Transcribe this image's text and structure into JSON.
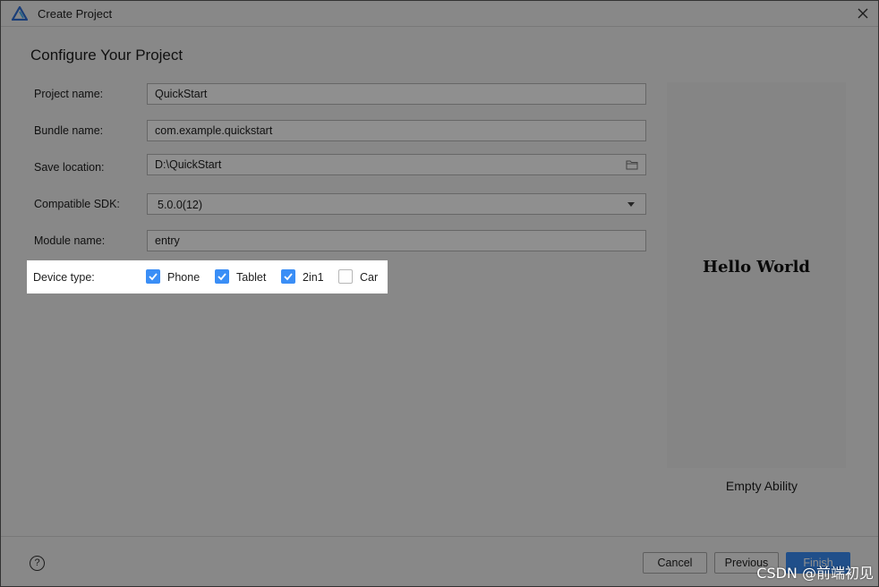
{
  "window": {
    "title": "Create Project",
    "app_icon": "deveco-logo-icon",
    "close_icon": "close-icon"
  },
  "heading": "Configure Your Project",
  "form": {
    "project_name": {
      "label": "Project name:",
      "value": "QuickStart"
    },
    "bundle_name": {
      "label": "Bundle name:",
      "value": "com.example.quickstart"
    },
    "save_location": {
      "label": "Save location:",
      "value": "D:\\QuickStart",
      "icon": "folder-icon"
    },
    "compatible_sdk": {
      "label": "Compatible SDK:",
      "value": "5.0.0(12)"
    },
    "module_name": {
      "label": "Module name:",
      "value": "entry"
    },
    "device_type": {
      "label": "Device type:",
      "options": [
        {
          "label": "Phone",
          "checked": true
        },
        {
          "label": "Tablet",
          "checked": true
        },
        {
          "label": "2in1",
          "checked": true
        },
        {
          "label": "Car",
          "checked": false
        }
      ]
    }
  },
  "preview": {
    "text": "Hello World",
    "template_name": "Empty Ability"
  },
  "footer": {
    "help_icon": "help-icon",
    "help_symbol": "?",
    "cancel_label": "Cancel",
    "previous_label": "Previous",
    "finish_label": "Finish"
  },
  "watermark": "CSDN @前端初见",
  "colors": {
    "accent": "#3a8ef6",
    "background": "#f2f2f2",
    "overlay": "rgba(0,0,0,0.44)"
  }
}
